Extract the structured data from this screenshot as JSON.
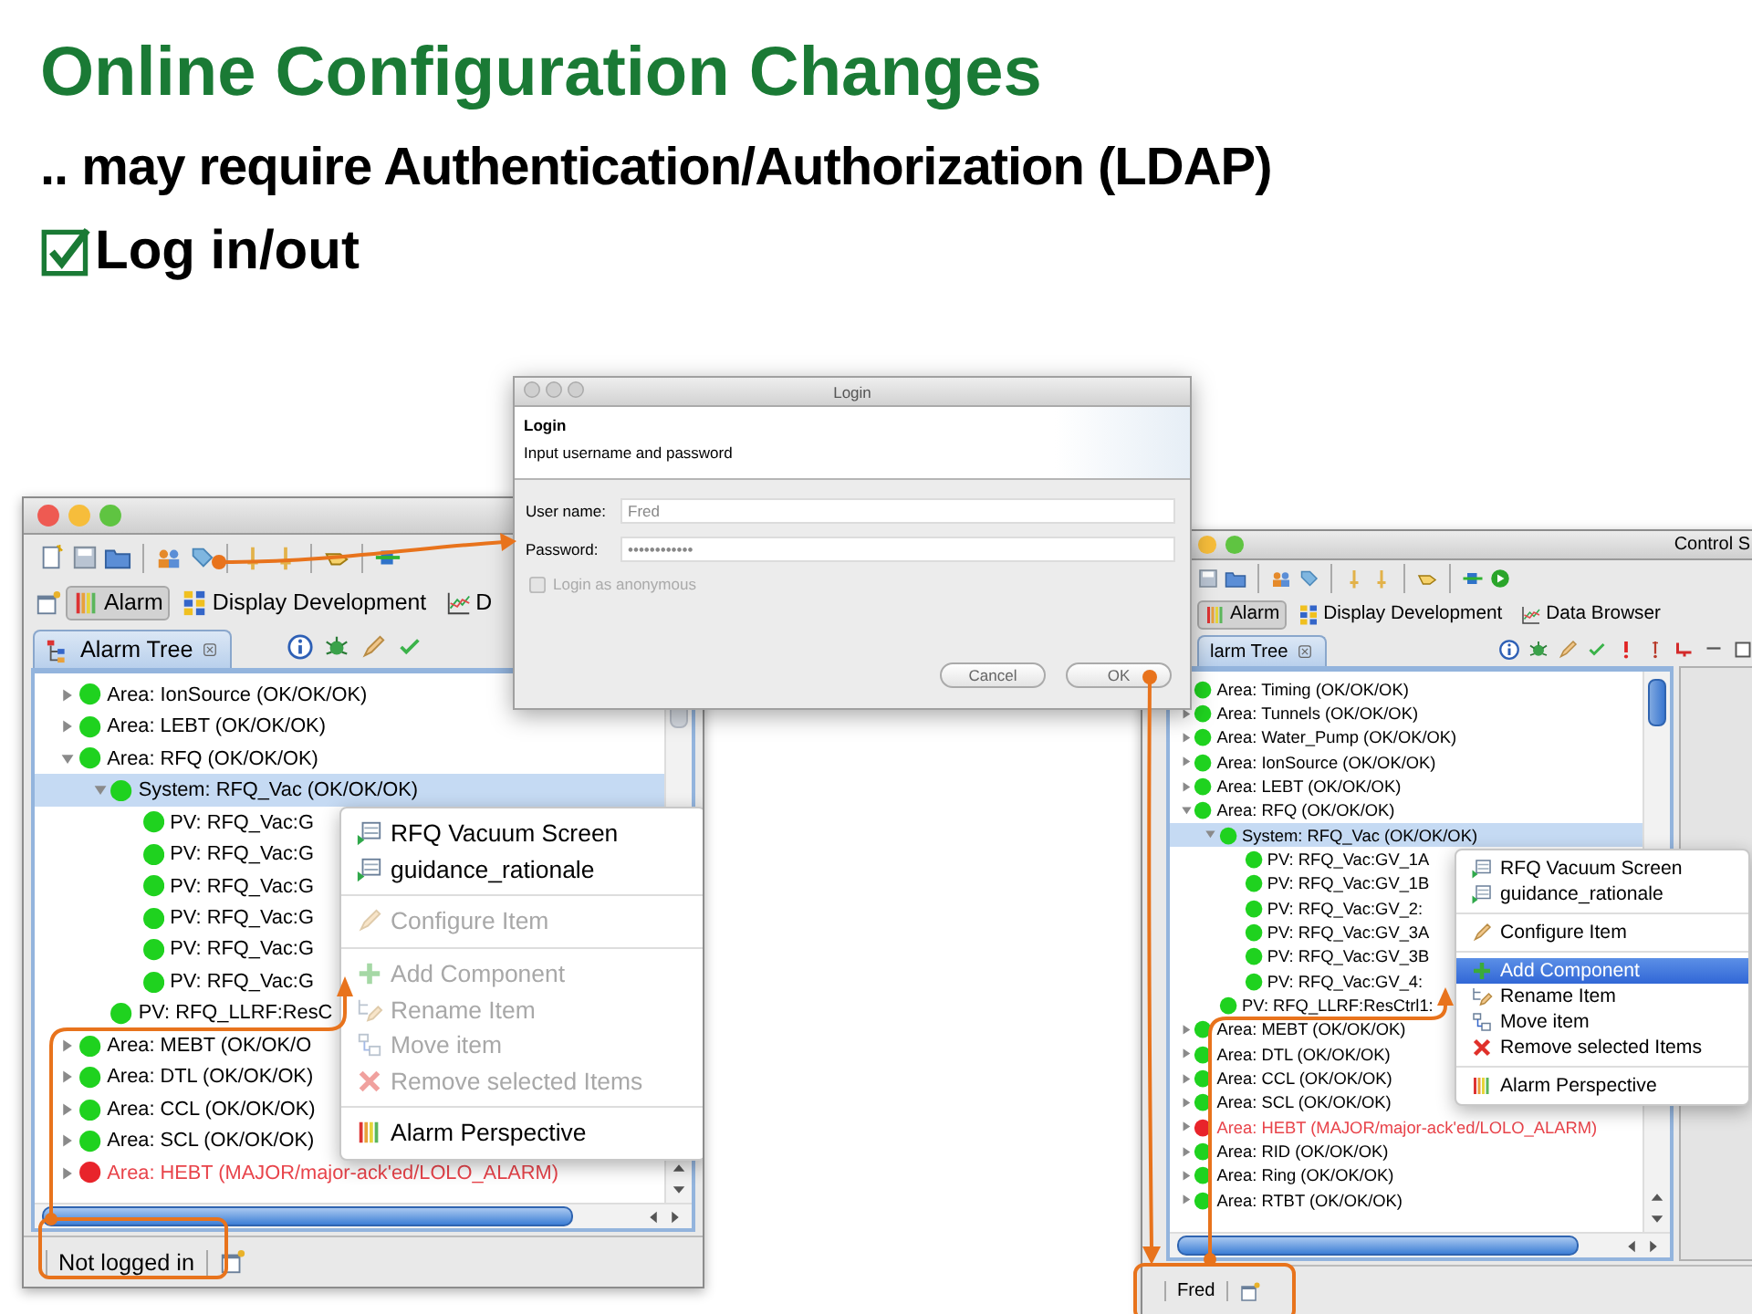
{
  "slide": {
    "title": "Online Configuration Changes",
    "subtitle": ".. may require Authentication/Authorization (LDAP)",
    "bullet": {
      "text": "Log in/out",
      "checked": true
    }
  },
  "windows": [
    {
      "perspectives": [
        {
          "label": "Alarm",
          "kind": "alarm",
          "selected": true
        },
        {
          "label": "Display Development",
          "kind": "display",
          "selected": false
        },
        {
          "label": "D",
          "kind": "chart",
          "selected": false
        }
      ],
      "view_tab": "Alarm Tree",
      "tree": [
        {
          "label": "Area: IonSource (OK/OK/OK)",
          "color": "#1fd21f",
          "alarm": false,
          "selected": false,
          "expanded": false
        },
        {
          "label": "Area: LEBT (OK/OK/OK)",
          "color": "#1fd21f",
          "alarm": false,
          "selected": false,
          "expanded": false
        },
        {
          "label": "Area: RFQ (OK/OK/OK)",
          "color": "#1fd21f",
          "alarm": false,
          "selected": false,
          "expanded": true,
          "children": [
            {
              "label": "System: RFQ_Vac (OK/OK/OK)",
              "color": "#1fd21f",
              "alarm": false,
              "selected": true,
              "expanded": true,
              "children": [
                {
                  "label": "PV: RFQ_Vac:G",
                  "color": "#1fd21f",
                  "alarm": false,
                  "selected": false
                },
                {
                  "label": "PV: RFQ_Vac:G",
                  "color": "#1fd21f",
                  "alarm": false,
                  "selected": false
                },
                {
                  "label": "PV: RFQ_Vac:G",
                  "color": "#1fd21f",
                  "alarm": false,
                  "selected": false
                },
                {
                  "label": "PV: RFQ_Vac:G",
                  "color": "#1fd21f",
                  "alarm": false,
                  "selected": false
                },
                {
                  "label": "PV: RFQ_Vac:G",
                  "color": "#1fd21f",
                  "alarm": false,
                  "selected": false
                },
                {
                  "label": "PV: RFQ_Vac:G",
                  "color": "#1fd21f",
                  "alarm": false,
                  "selected": false
                }
              ]
            },
            {
              "label": "PV: RFQ_LLRF:ResC",
              "color": "#1fd21f",
              "alarm": false,
              "selected": false
            }
          ]
        },
        {
          "label": "Area: MEBT (OK/OK/O",
          "color": "#1fd21f",
          "alarm": false,
          "selected": false,
          "expanded": false
        },
        {
          "label": "Area: DTL (OK/OK/OK)",
          "color": "#1fd21f",
          "alarm": false,
          "selected": false,
          "expanded": false
        },
        {
          "label": "Area: CCL (OK/OK/OK)",
          "color": "#1fd21f",
          "alarm": false,
          "selected": false,
          "expanded": false
        },
        {
          "label": "Area: SCL (OK/OK/OK)",
          "color": "#1fd21f",
          "alarm": false,
          "selected": false,
          "expanded": false
        },
        {
          "label": "Area: HEBT (MAJOR/major-ack'ed/LOLO_ALARM)",
          "color": "#e8242b",
          "alarm": true,
          "selected": false,
          "expanded": false
        }
      ],
      "menu": [
        [
          {
            "label": "RFQ Vacuum Screen",
            "kind": "display",
            "disabled": false,
            "selected": false
          },
          {
            "label": "guidance_rationale",
            "kind": "display",
            "disabled": false,
            "selected": false
          }
        ],
        [
          {
            "label": "Configure Item",
            "kind": "configure",
            "disabled": true,
            "selected": false
          }
        ],
        [
          {
            "label": "Add Component",
            "kind": "add",
            "disabled": true,
            "selected": false
          },
          {
            "label": "Rename Item",
            "kind": "rename",
            "disabled": true,
            "selected": false
          },
          {
            "label": "Move item",
            "kind": "move",
            "disabled": true,
            "selected": false
          },
          {
            "label": "Remove selected Items",
            "kind": "remove",
            "disabled": true,
            "selected": false
          }
        ],
        [
          {
            "label": "Alarm Perspective",
            "kind": "perspective",
            "disabled": false,
            "selected": false
          }
        ]
      ],
      "status": "Not logged in"
    },
    {
      "title": "Control S",
      "perspectives": [
        {
          "label": "Alarm",
          "kind": "alarm",
          "selected": true
        },
        {
          "label": "Display Development",
          "kind": "display",
          "selected": false
        },
        {
          "label": "Data Browser",
          "kind": "chart",
          "selected": false
        }
      ],
      "view_tab": "larm Tree",
      "tree": [
        {
          "label": "Area: Timing (OK/OK/OK)",
          "color": "#1fd21f",
          "alarm": false,
          "selected": false
        },
        {
          "label": "Area: Tunnels (OK/OK/OK)",
          "color": "#1fd21f",
          "alarm": false,
          "selected": false,
          "expanded": false
        },
        {
          "label": "Area: Water_Pump (OK/OK/OK)",
          "color": "#1fd21f",
          "alarm": false,
          "selected": false,
          "expanded": false
        },
        {
          "label": "Area: IonSource (OK/OK/OK)",
          "color": "#1fd21f",
          "alarm": false,
          "selected": false,
          "expanded": false
        },
        {
          "label": "Area: LEBT (OK/OK/OK)",
          "color": "#1fd21f",
          "alarm": false,
          "selected": false,
          "expanded": false
        },
        {
          "label": "Area: RFQ (OK/OK/OK)",
          "color": "#1fd21f",
          "alarm": false,
          "selected": false,
          "expanded": true,
          "children": [
            {
              "label": "System: RFQ_Vac (OK/OK/OK)",
              "color": "#1fd21f",
              "alarm": false,
              "selected": true,
              "expanded": true,
              "children": [
                {
                  "label": "PV: RFQ_Vac:GV_1A",
                  "color": "#1fd21f",
                  "alarm": false,
                  "selected": false
                },
                {
                  "label": "PV: RFQ_Vac:GV_1B",
                  "color": "#1fd21f",
                  "alarm": false,
                  "selected": false
                },
                {
                  "label": "PV: RFQ_Vac:GV_2:",
                  "color": "#1fd21f",
                  "alarm": false,
                  "selected": false
                },
                {
                  "label": "PV: RFQ_Vac:GV_3A",
                  "color": "#1fd21f",
                  "alarm": false,
                  "selected": false
                },
                {
                  "label": "PV: RFQ_Vac:GV_3B",
                  "color": "#1fd21f",
                  "alarm": false,
                  "selected": false
                },
                {
                  "label": "PV: RFQ_Vac:GV_4:",
                  "color": "#1fd21f",
                  "alarm": false,
                  "selected": false
                }
              ]
            },
            {
              "label": "PV: RFQ_LLRF:ResCtrl1:",
              "color": "#1fd21f",
              "alarm": false,
              "selected": false
            }
          ]
        },
        {
          "label": "Area: MEBT (OK/OK/OK)",
          "color": "#1fd21f",
          "alarm": false,
          "selected": false,
          "expanded": false
        },
        {
          "label": "Area: DTL (OK/OK/OK)",
          "color": "#1fd21f",
          "alarm": false,
          "selected": false,
          "expanded": false
        },
        {
          "label": "Area: CCL (OK/OK/OK)",
          "color": "#1fd21f",
          "alarm": false,
          "selected": false,
          "expanded": false
        },
        {
          "label": "Area: SCL (OK/OK/OK)",
          "color": "#1fd21f",
          "alarm": false,
          "selected": false,
          "expanded": false
        },
        {
          "label": "Area: HEBT (MAJOR/major-ack'ed/LOLO_ALARM)",
          "color": "#e8242b",
          "alarm": true,
          "selected": false,
          "expanded": false
        },
        {
          "label": "Area: RID (OK/OK/OK)",
          "color": "#1fd21f",
          "alarm": false,
          "selected": false,
          "expanded": false
        },
        {
          "label": "Area: Ring (OK/OK/OK)",
          "color": "#1fd21f",
          "alarm": false,
          "selected": false,
          "expanded": false
        },
        {
          "label": "Area: RTBT (OK/OK/OK)",
          "color": "#1fd21f",
          "alarm": false,
          "selected": false,
          "expanded": false
        }
      ],
      "menu": [
        [
          {
            "label": "RFQ Vacuum Screen",
            "kind": "display",
            "disabled": false,
            "selected": false
          },
          {
            "label": "guidance_rationale",
            "kind": "display",
            "disabled": false,
            "selected": false
          }
        ],
        [
          {
            "label": "Configure Item",
            "kind": "configure",
            "disabled": false,
            "selected": false
          }
        ],
        [
          {
            "label": "Add Component",
            "kind": "add",
            "disabled": false,
            "selected": true
          },
          {
            "label": "Rename Item",
            "kind": "rename",
            "disabled": false,
            "selected": false
          },
          {
            "label": "Move item",
            "kind": "move",
            "disabled": false,
            "selected": false
          },
          {
            "label": "Remove selected Items",
            "kind": "remove",
            "disabled": false,
            "selected": false
          }
        ],
        [
          {
            "label": "Alarm Perspective",
            "kind": "perspective",
            "disabled": false,
            "selected": false
          }
        ]
      ],
      "status": "Fred"
    }
  ],
  "login_dialog": {
    "title": "Login",
    "header": "Login",
    "message": "Input username and password",
    "fields": [
      {
        "label": "User name:",
        "value": "Fred"
      },
      {
        "label": "Password:",
        "value": "••••••••••••"
      }
    ],
    "anonymous": {
      "label": "Login as anonymous",
      "checked": false,
      "disabled": true
    },
    "buttons": [
      "Cancel",
      "OK"
    ]
  }
}
